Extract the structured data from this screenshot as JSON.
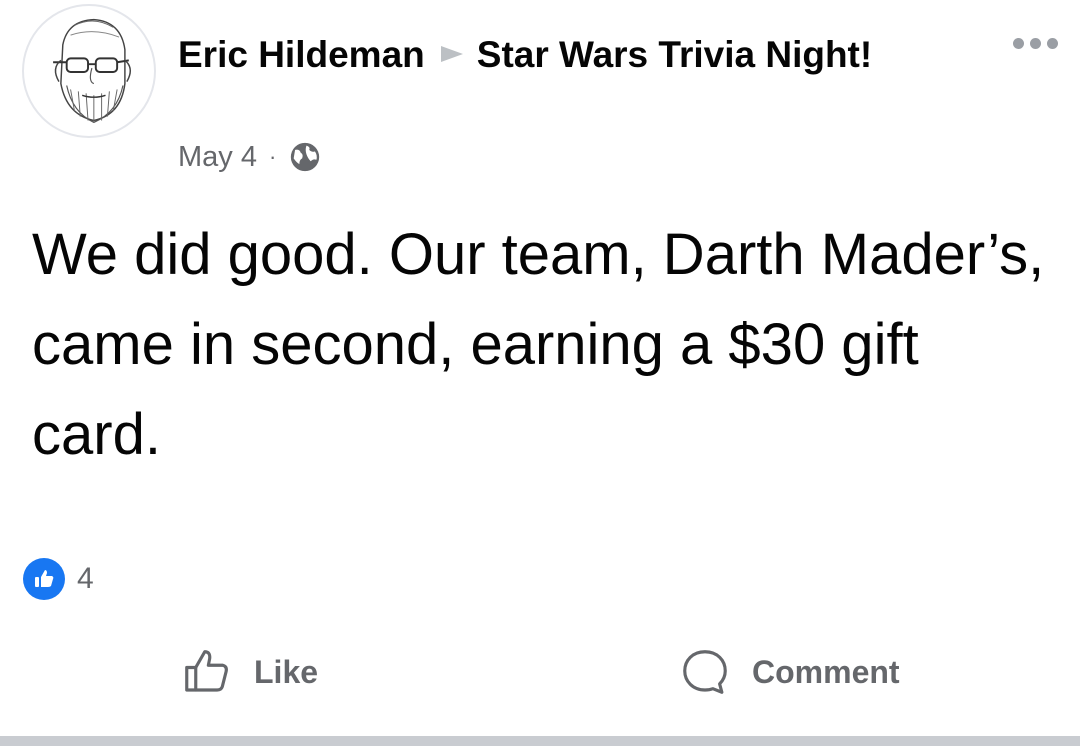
{
  "post": {
    "author": "Eric Hildeman",
    "event": "Star Wars Trivia Night!",
    "date": "May 4",
    "separator": "·",
    "privacy_icon": "globe-icon",
    "body": "We did good. Our team, Darth Mader’s, came in second, earning a $30 gift card.",
    "reactions": {
      "icon": "thumbs-up-icon",
      "count": "4",
      "color": "#1877f2"
    }
  },
  "actions": {
    "like_label": "Like",
    "comment_label": "Comment"
  },
  "icons": {
    "more": "more-horizontal-icon",
    "like": "like-outline-icon",
    "comment": "comment-bubble-icon"
  }
}
